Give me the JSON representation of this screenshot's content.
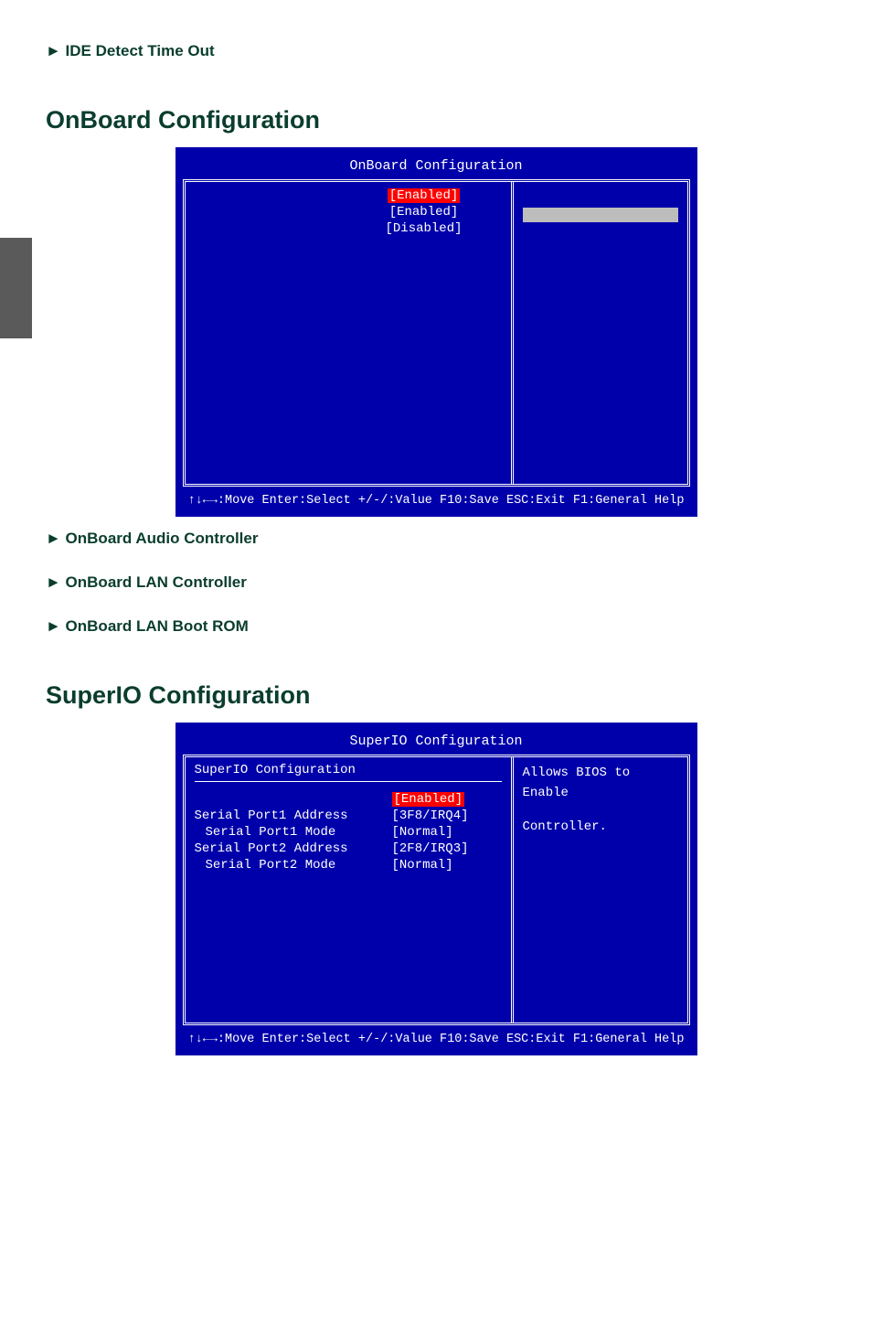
{
  "items": {
    "ide_detect": {
      "title": "► IDE Detect Time Out",
      "desc": ""
    },
    "audio": {
      "title": "► OnBoard Audio Controller",
      "desc": ""
    },
    "lan_ctrl": {
      "title": "► OnBoard LAN Controller",
      "desc": ""
    },
    "lan_boot": {
      "title": "► OnBoard LAN Boot ROM",
      "desc": ""
    }
  },
  "sections": {
    "onboard": "OnBoard Configuration",
    "superio": "SuperIO Configuration"
  },
  "bios_onboard": {
    "title": "OnBoard Configuration",
    "rows": [
      {
        "label": "",
        "value": "[Enabled]",
        "hl": true
      },
      {
        "label": "",
        "value": "[Enabled]"
      },
      {
        "label": "",
        "value": "[Disabled]"
      }
    ],
    "help1": "",
    "help2": "",
    "footer": {
      "move": "↑↓←→:Move",
      "select": "Enter:Select",
      "value": "+/-/:Value",
      "save": "F10:Save",
      "exit": "ESC:Exit",
      "help": "F1:General Help"
    }
  },
  "bios_superio": {
    "title": "SuperIO Configuration",
    "subhead": "SuperIO Configuration",
    "rows": [
      {
        "label": "",
        "value": "[Enabled]",
        "hl": true
      },
      {
        "label": "Serial Port1 Address",
        "value": "[3F8/IRQ4]"
      },
      {
        "label": "Serial Port1 Mode",
        "value": "[Normal]",
        "indent": true
      },
      {
        "label": "Serial Port2 Address",
        "value": "[2F8/IRQ3]"
      },
      {
        "label": "Serial Port2 Mode",
        "value": "[Normal]",
        "indent": true
      }
    ],
    "help1": "Allows BIOS to Enable",
    "help2": "Controller.",
    "footer": {
      "move": "↑↓←→:Move",
      "select": "Enter:Select",
      "value": "+/-/:Value",
      "save": "F10:Save",
      "exit": "ESC:Exit",
      "help": "F1:General Help"
    }
  }
}
